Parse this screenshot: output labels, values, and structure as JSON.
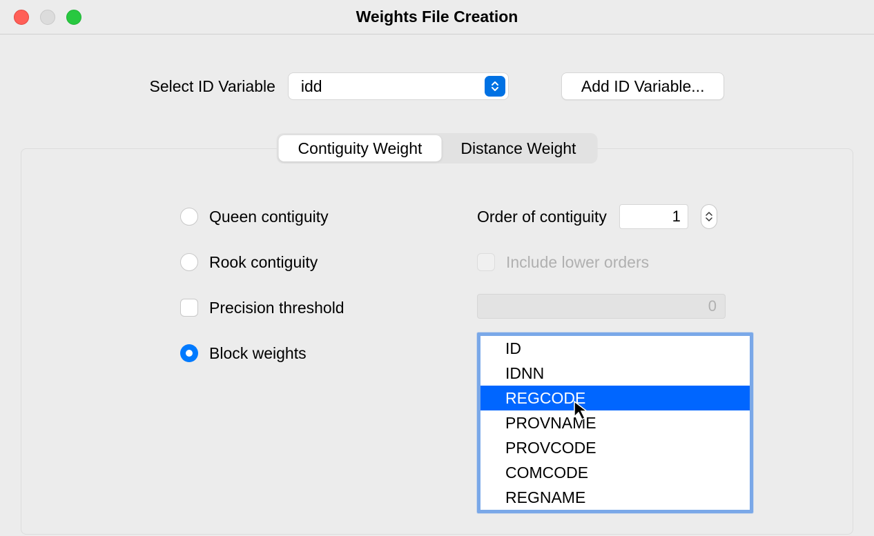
{
  "window": {
    "title": "Weights File Creation"
  },
  "id_section": {
    "label": "Select ID Variable",
    "selected": "idd",
    "add_button": "Add ID Variable..."
  },
  "tabs": {
    "contiguity": "Contiguity Weight",
    "distance": "Distance Weight"
  },
  "contiguity": {
    "queen": "Queen contiguity",
    "rook": "Rook contiguity",
    "precision": "Precision threshold",
    "block": "Block weights",
    "order_label": "Order of contiguity",
    "order_value": "1",
    "include_lower": "Include lower orders",
    "threshold_value": "0"
  },
  "block_vars": {
    "items": [
      "ID",
      "IDNN",
      "REGCODE",
      "PROVNAME",
      "PROVCODE",
      "COMCODE",
      "REGNAME"
    ],
    "selected_index": 2
  }
}
